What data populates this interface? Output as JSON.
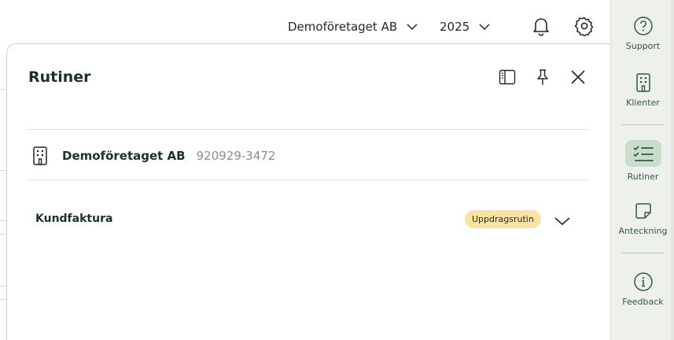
{
  "topbar": {
    "company": "Demoföretaget AB",
    "year": "2025"
  },
  "rail": {
    "items": [
      {
        "label": "Support",
        "icon": "help-circle-icon"
      },
      {
        "label": "Klienter",
        "icon": "building-icon"
      },
      {
        "label": "Rutiner",
        "icon": "checklist-icon",
        "active": true
      },
      {
        "label": "Anteckning",
        "icon": "note-icon"
      },
      {
        "label": "Feedback",
        "icon": "info-circle-icon"
      }
    ]
  },
  "panel": {
    "title": "Rutiner",
    "company_name": "Demoföretaget AB",
    "org_number": "920929-3472",
    "routines": [
      {
        "name": "Kundfaktura",
        "badge": "Uppdragsrutin"
      }
    ]
  },
  "colors": {
    "accent": "#2f5a40",
    "rail_bg": "#eef0ec",
    "active_bg": "#c9ddcc",
    "badge_bg": "#f9e3a1"
  }
}
